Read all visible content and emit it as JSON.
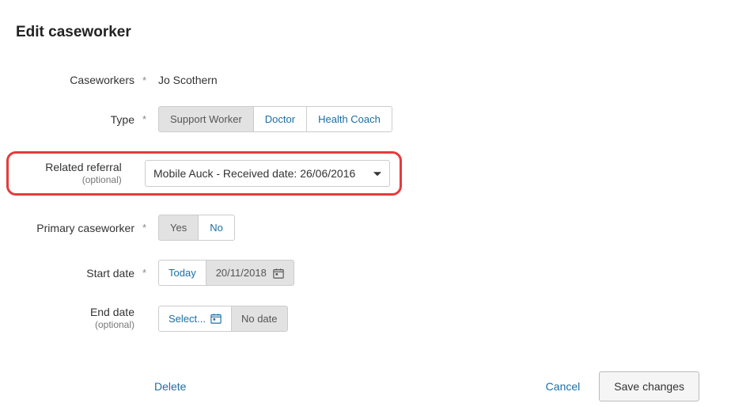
{
  "title": "Edit caseworker",
  "fields": {
    "caseworkers": {
      "label": "Caseworkers",
      "required": true,
      "value": "Jo Scothern"
    },
    "type": {
      "label": "Type",
      "required": true,
      "options": [
        "Support Worker",
        "Doctor",
        "Health Coach"
      ],
      "selected": "Support Worker"
    },
    "related_referral": {
      "label": "Related referral",
      "optional_label": "(optional)",
      "value": "Mobile Auck - Received date: 26/06/2016"
    },
    "primary": {
      "label": "Primary caseworker",
      "required": true,
      "options": [
        "Yes",
        "No"
      ],
      "selected": "Yes"
    },
    "start_date": {
      "label": "Start date",
      "required": true,
      "quick_label": "Today",
      "value": "20/11/2018"
    },
    "end_date": {
      "label": "End date",
      "optional_label": "(optional)",
      "picker_label": "Select...",
      "value": "No date"
    }
  },
  "actions": {
    "delete": "Delete",
    "cancel": "Cancel",
    "save": "Save changes"
  },
  "asterisk": "*"
}
